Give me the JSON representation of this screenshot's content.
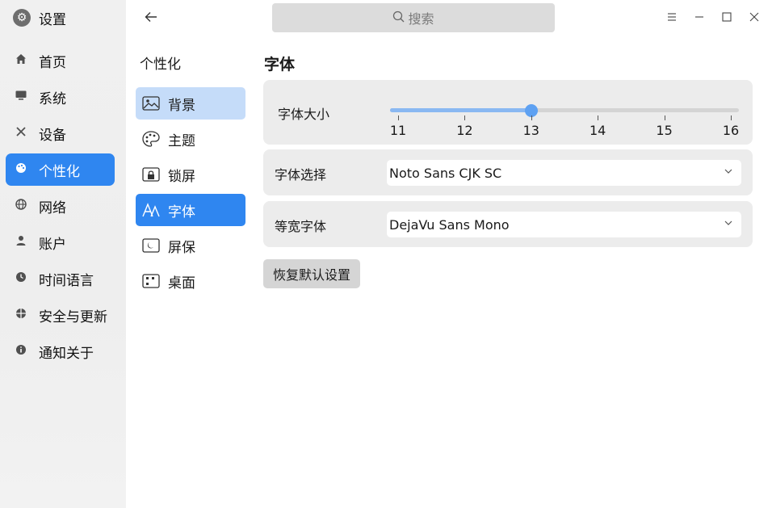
{
  "app": {
    "title": "设置",
    "icon": "gear-icon"
  },
  "search": {
    "placeholder": "搜索"
  },
  "sidebar": {
    "items": [
      {
        "label": "首页",
        "icon": "home-icon"
      },
      {
        "label": "系统",
        "icon": "monitor-icon"
      },
      {
        "label": "设备",
        "icon": "tools-icon"
      },
      {
        "label": "个性化",
        "icon": "palette-icon",
        "active": true
      },
      {
        "label": "网络",
        "icon": "globe-icon"
      },
      {
        "label": "账户",
        "icon": "user-icon"
      },
      {
        "label": "时间语言",
        "icon": "clock-icon"
      },
      {
        "label": "安全与更新",
        "icon": "shield-icon"
      },
      {
        "label": "通知关于",
        "icon": "info-icon"
      }
    ]
  },
  "subnav": {
    "title": "个性化",
    "items": [
      {
        "label": "背景",
        "icon": "image-icon"
      },
      {
        "label": "主题",
        "icon": "theme-palette-icon"
      },
      {
        "label": "锁屏",
        "icon": "lockscreen-icon"
      },
      {
        "label": "字体",
        "icon": "font-icon",
        "active": true
      },
      {
        "label": "屏保",
        "icon": "screensaver-icon"
      },
      {
        "label": "桌面",
        "icon": "desktop-grid-icon"
      }
    ]
  },
  "content": {
    "title": "字体",
    "font_size": {
      "label": "字体大小",
      "ticks": [
        "11",
        "12",
        "13",
        "14",
        "15",
        "16"
      ],
      "value": 13,
      "min": 11,
      "max": 16
    },
    "font_select": {
      "label": "字体选择",
      "value": "Noto Sans CJK SC"
    },
    "mono_font": {
      "label": "等宽字体",
      "value": "DejaVu Sans Mono"
    },
    "reset_label": "恢复默认设置"
  },
  "colors": {
    "accent": "#2f86f0",
    "accent_light": "#c5dcf9",
    "slider_fill": "#8ab8f2"
  }
}
